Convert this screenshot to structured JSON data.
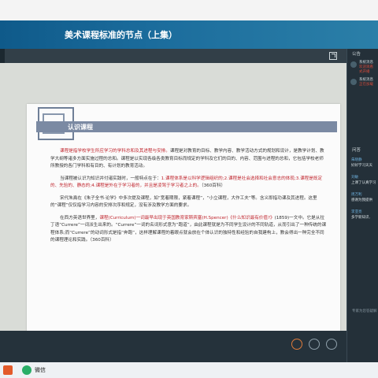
{
  "header": {
    "title": "美术课程标准的节点（上集）"
  },
  "slide": {
    "heading": "认识课程",
    "paragraphs": [
      {
        "red": "课程是指学校学生所应学习的学科总和及其进程与安排。",
        "text": "课程是对教育的目标、教学内容、教学活动方式的规划和设计，是教学计划、教学大纲等诸多方面实施过程的总和。课程是以实现各级各类教育目标而规定的学科及它们的目的、内容、范围与进程的总和，它包括学校老师所教授的各门学科和有目的、有计划的教育活动。"
      },
      {
        "text": "当课程被认识为知识并付诸实践时，一般特点在于：",
        "red": "1.课程体系是以科学逻辑组织的;2.课程是社会选择和社会意志的体现;3.课程是既定的、先验的、静态的;4.课程是外在于学习者的，并且是凌驾于学习者之上的。",
        "tail": "（360百科）"
      },
      {
        "text": "宋代朱熹在《朱子全书·论学》中多次提及课程，如“宽着期限，紧着课程”，“小立课程，大作工夫”等。含义即指功课及其进程。这里的“课程”仅仅指学习内容的安排次序和规定，没有涉及教学方面的要求。"
      },
      {
        "text": "在西方英语世界里，",
        "red": "课程(Curriculum)一词最早出现于英国教育家斯宾塞(H.Spencer)《什么知识最有价值?》",
        "tail": "(1859)一文中。它是从拉丁语“Currere”一词派生出来的。“Currere”一词的名词形式意为“跑道”，由此课程就是为不同学生设计的不同轨道，从而引出了一种传统的课程体系;而“Currere”的动词形式是指“奔跑”，这样理解课程的着眼点就会放在个体认识的独特性和经验的自我建构上，教会得出一种完全不同的课程理论和实践。（360百科）"
      }
    ]
  },
  "panel": {
    "notice_label": "公告",
    "notices": [
      {
        "title": "系统消息",
        "line1": "欢迎观看",
        "line2": "式开播"
      },
      {
        "title": "系统消息",
        "line1": "正在加载",
        "line2": ""
      }
    ],
    "qa_label": "问答",
    "messages": [
      {
        "name": "朱晓静",
        "msg": "好好学习天天"
      },
      {
        "name": "刘敏",
        "msg": "上课了认真学习"
      },
      {
        "name": "周万利",
        "msg": "感谢为我提供"
      },
      {
        "name": "李亚亮",
        "msg": "多学新知识,"
      }
    ],
    "ask_hint": "专家为您答疑解"
  },
  "taskbar": {
    "wechat_label": "微信"
  }
}
